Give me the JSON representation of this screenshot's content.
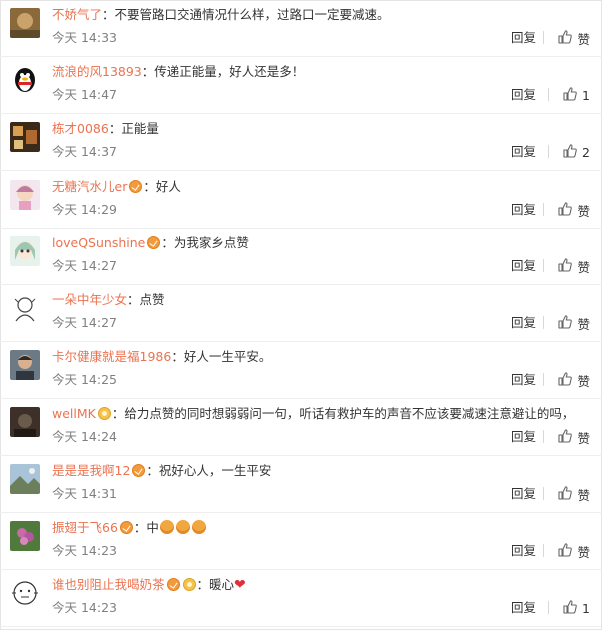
{
  "ui": {
    "reply_label": "回复",
    "like_word": "赞",
    "separator": "："
  },
  "colors": {
    "username": "#eb7350",
    "meta": "#808080"
  },
  "comments": [
    {
      "user": "不娇气了",
      "badge": "",
      "text": "不要管路口交通情况什么样，过路口一定要减速。",
      "time": "今天 14:33",
      "likes": "",
      "avatar": "photo-nature"
    },
    {
      "user": "流浪的风13893",
      "badge": "",
      "text": "传递正能量，好人还是多！",
      "time": "今天 14:47",
      "likes": "1",
      "avatar": "penguin"
    },
    {
      "user": "栋才0086",
      "badge": "",
      "text": "正能量",
      "time": "今天 14:37",
      "likes": "2",
      "avatar": "photo-warm"
    },
    {
      "user": "无糖汽水儿er",
      "badge": "orange",
      "text": "好人",
      "time": "今天 14:29",
      "likes": "",
      "avatar": "cartoon-girl"
    },
    {
      "user": "loveQSunshine",
      "badge": "orange",
      "text": "为我家乡点赞",
      "time": "今天 14:27",
      "likes": "",
      "avatar": "anime"
    },
    {
      "user": "一朵中年少女",
      "badge": "",
      "text": "点赞",
      "time": "今天 14:27",
      "likes": "",
      "avatar": "sketch"
    },
    {
      "user": "卡尔健康就是福1986",
      "badge": "",
      "text": "好人一生平安。",
      "time": "今天 14:25",
      "likes": "",
      "avatar": "portrait"
    },
    {
      "user": "wellMK",
      "badge": "gold",
      "text": "给力点赞的同时想弱弱问一句，听话有救护车的声音不应该要减速注意避让的吗，",
      "time": "今天 14:24",
      "likes": "",
      "avatar": "dark-photo"
    },
    {
      "user": "是是是我啊12",
      "badge": "orange",
      "text": "祝好心人，一生平安",
      "time": "今天 14:31",
      "likes": "",
      "avatar": "landscape"
    },
    {
      "user": "振翅于飞66",
      "badge": "orange",
      "text": "中",
      "emoji_count": 3,
      "time": "今天 14:23",
      "likes": "",
      "avatar": "flower"
    },
    {
      "user": "谁也别阻止我喝奶茶",
      "badge": "both",
      "text": "暖心",
      "heart": "❤",
      "time": "今天 14:23",
      "likes": "1",
      "avatar": "doodle"
    }
  ]
}
